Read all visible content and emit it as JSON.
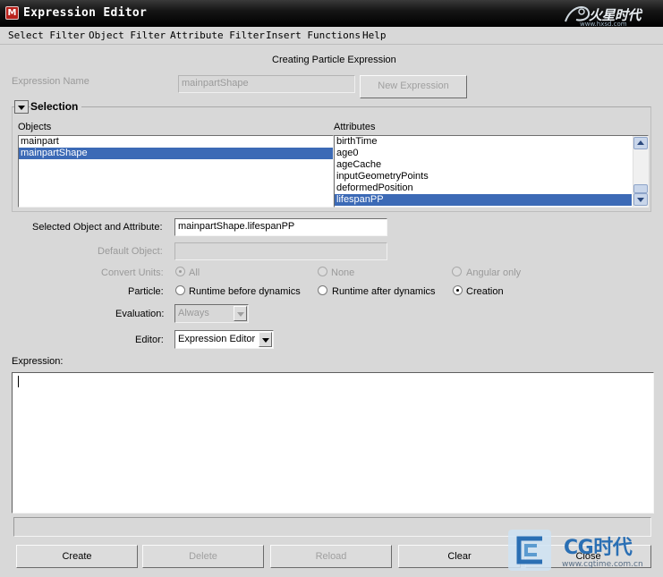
{
  "window": {
    "title": "Expression Editor",
    "icon": "maya-app-icon",
    "watermark_top": "火星时代",
    "watermark_top_url": "www.hxsd.com"
  },
  "menu": [
    "Select Filter",
    "Object Filter",
    "Attribute Filter",
    "Insert Functions",
    "Help"
  ],
  "header": {
    "mode_text": "Creating Particle Expression",
    "expression_name_label": "Expression Name",
    "expression_name_value": "mainpartShape",
    "new_expression_button": "New Expression"
  },
  "selection": {
    "title": "Selection",
    "objects_label": "Objects",
    "attributes_label": "Attributes",
    "objects": [
      "mainpart",
      "mainpartShape"
    ],
    "selected_object_index": 1,
    "attributes": [
      "birthTime",
      "age0",
      "ageCache",
      "inputGeometryPoints",
      "deformedPosition",
      "lifespanPP"
    ],
    "selected_attribute_index": 5
  },
  "form": {
    "selected_label": "Selected Object and Attribute:",
    "selected_value": "mainpartShape.lifespanPP",
    "default_object_label": "Default Object:",
    "default_object_value": "",
    "convert_units_label": "Convert Units:",
    "convert_units_options": [
      "All",
      "None",
      "Angular only"
    ],
    "convert_units_selected": 0,
    "particle_label": "Particle:",
    "particle_options": [
      "Runtime before dynamics",
      "Runtime after dynamics",
      "Creation"
    ],
    "particle_selected": 2,
    "evaluation_label": "Evaluation:",
    "evaluation_value": "Always",
    "editor_label": "Editor:",
    "editor_value": "Expression Editor"
  },
  "expression": {
    "label": "Expression:",
    "text": ""
  },
  "buttons": {
    "create": "Create",
    "delete": "Delete",
    "reload": "Reload",
    "clear": "Clear",
    "close": "Close"
  },
  "watermark_bottom": {
    "text": "CG时代",
    "url": "www.cgtime.com.cn"
  },
  "colors": {
    "selection": "#3c6ab6",
    "background": "#d8d8d8",
    "titlebar": "#000000"
  }
}
